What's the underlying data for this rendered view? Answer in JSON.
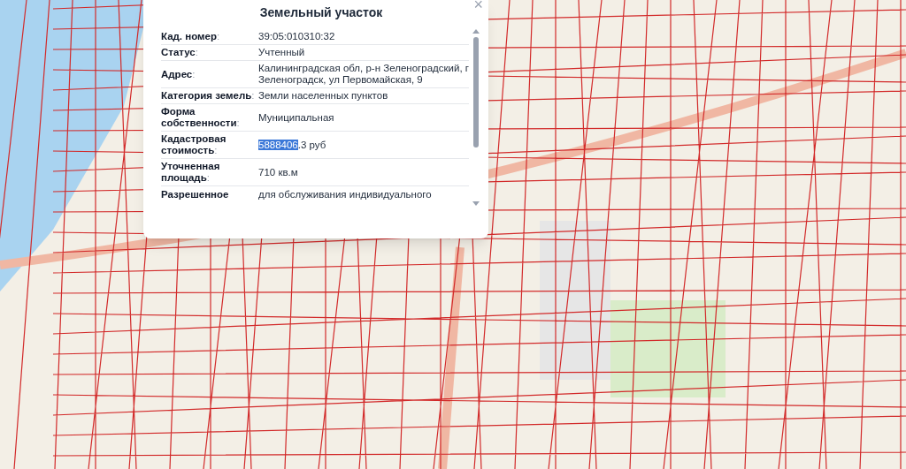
{
  "popup": {
    "title": "Земельный участок",
    "close": "×",
    "rows": [
      {
        "label": "Кад. номер",
        "colon": ":",
        "parts": [
          {
            "text": "39:05:010310:32",
            "selected": false
          }
        ]
      },
      {
        "label": "Статус",
        "colon": ":",
        "parts": [
          {
            "text": "Учтенный",
            "selected": false
          }
        ]
      },
      {
        "label": "Адрес",
        "colon": ":",
        "parts": [
          {
            "text": "Калининградская обл, р-н Зеленоградский, г Зеленоградск, ул Первомайская, 9",
            "selected": false
          }
        ]
      },
      {
        "label": "Категория земель",
        "colon": ":",
        "parts": [
          {
            "text": "Земли населенных пунктов",
            "selected": false
          }
        ]
      },
      {
        "label": "Форма собственности",
        "colon": ":",
        "parts": [
          {
            "text": "Муниципальная",
            "selected": false
          }
        ]
      },
      {
        "label": "Кадастровая стоимость",
        "colon": ":",
        "parts": [
          {
            "text": "5888406",
            "selected": true
          },
          {
            "text": ".3 руб",
            "selected": false
          }
        ]
      },
      {
        "label": "Уточненная площадь",
        "colon": ":",
        "parts": [
          {
            "text": "710 кв.м",
            "selected": false
          }
        ]
      },
      {
        "label": "Разрешенное",
        "parts": [
          {
            "text": "для обслуживания индивидуального",
            "selected": false
          }
        ]
      }
    ]
  }
}
